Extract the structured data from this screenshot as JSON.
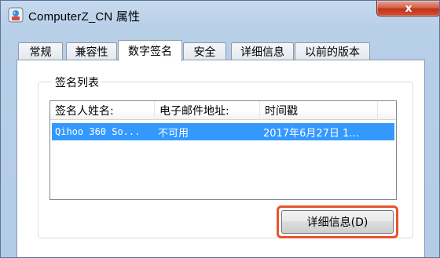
{
  "window": {
    "title": "ComputerZ_CN 属性",
    "close_label": "x"
  },
  "tabs": [
    {
      "label": "常规",
      "active": false
    },
    {
      "label": "兼容性",
      "active": false
    },
    {
      "label": "数字签名",
      "active": true
    },
    {
      "label": "安全",
      "active": false
    },
    {
      "label": "详细信息",
      "active": false
    },
    {
      "label": "以前的版本",
      "active": false
    }
  ],
  "signature_list": {
    "group_label": "签名列表",
    "columns": [
      "签名人姓名:",
      "电子邮件地址:",
      "时间戳"
    ],
    "rows": [
      {
        "name": "Qihoo 360 So...",
        "email": "不可用",
        "timestamp": "2017年6月27日 1..."
      }
    ]
  },
  "details_button": {
    "label": "详细信息(D)"
  },
  "colors": {
    "selection": "#3399ff",
    "highlight_border": "#e8542c"
  }
}
